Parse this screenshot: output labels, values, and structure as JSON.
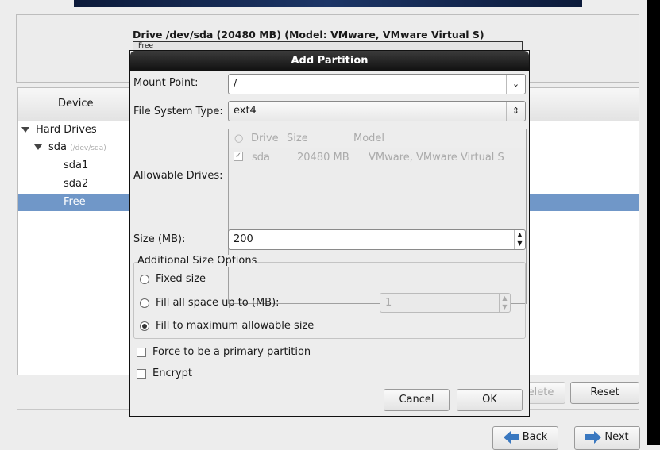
{
  "drive": {
    "title": "Drive /dev/sda (20480 MB) (Model: VMware, VMware Virtual S)",
    "bar_label": "Free"
  },
  "device_table": {
    "header": "Device",
    "rows": [
      {
        "label": "Hard Drives",
        "sub": ""
      },
      {
        "label": "sda",
        "sub": "(/dev/sda)"
      },
      {
        "label": "sda1",
        "sub": ""
      },
      {
        "label": "sda2",
        "sub": ""
      },
      {
        "label": "Free",
        "sub": "",
        "selected": true
      }
    ]
  },
  "buttons": {
    "delete": "Delete",
    "reset": "Reset",
    "back": "Back",
    "next": "Next"
  },
  "dialog": {
    "title": "Add Partition",
    "mount_point_label": "Mount Point:",
    "mount_point_value": "/",
    "fs_type_label": "File System Type:",
    "fs_type_value": "ext4",
    "allowable_drives_label": "Allowable Drives:",
    "drives_columns": [
      "Drive",
      "Size",
      "Model"
    ],
    "drives_rows": [
      {
        "checked": true,
        "drive": "sda",
        "size": "20480 MB",
        "model": "VMware, VMware Virtual S"
      }
    ],
    "size_label": "Size (MB):",
    "size_value": "200",
    "size_options_label": "Additional Size Options",
    "options": [
      "Fixed size",
      "Fill all space up to (MB):",
      "Fill to maximum allowable size"
    ],
    "selected_option": "Fill to maximum allowable size",
    "fill_up_value": "1",
    "force_primary": "Force to be a primary partition",
    "force_primary_checked": false,
    "encrypt": "Encrypt",
    "encrypt_checked": false,
    "cancel": "Cancel",
    "ok": "OK"
  },
  "colors": {
    "selection": "#7097c8",
    "titlebar": "#1e1e1e"
  }
}
